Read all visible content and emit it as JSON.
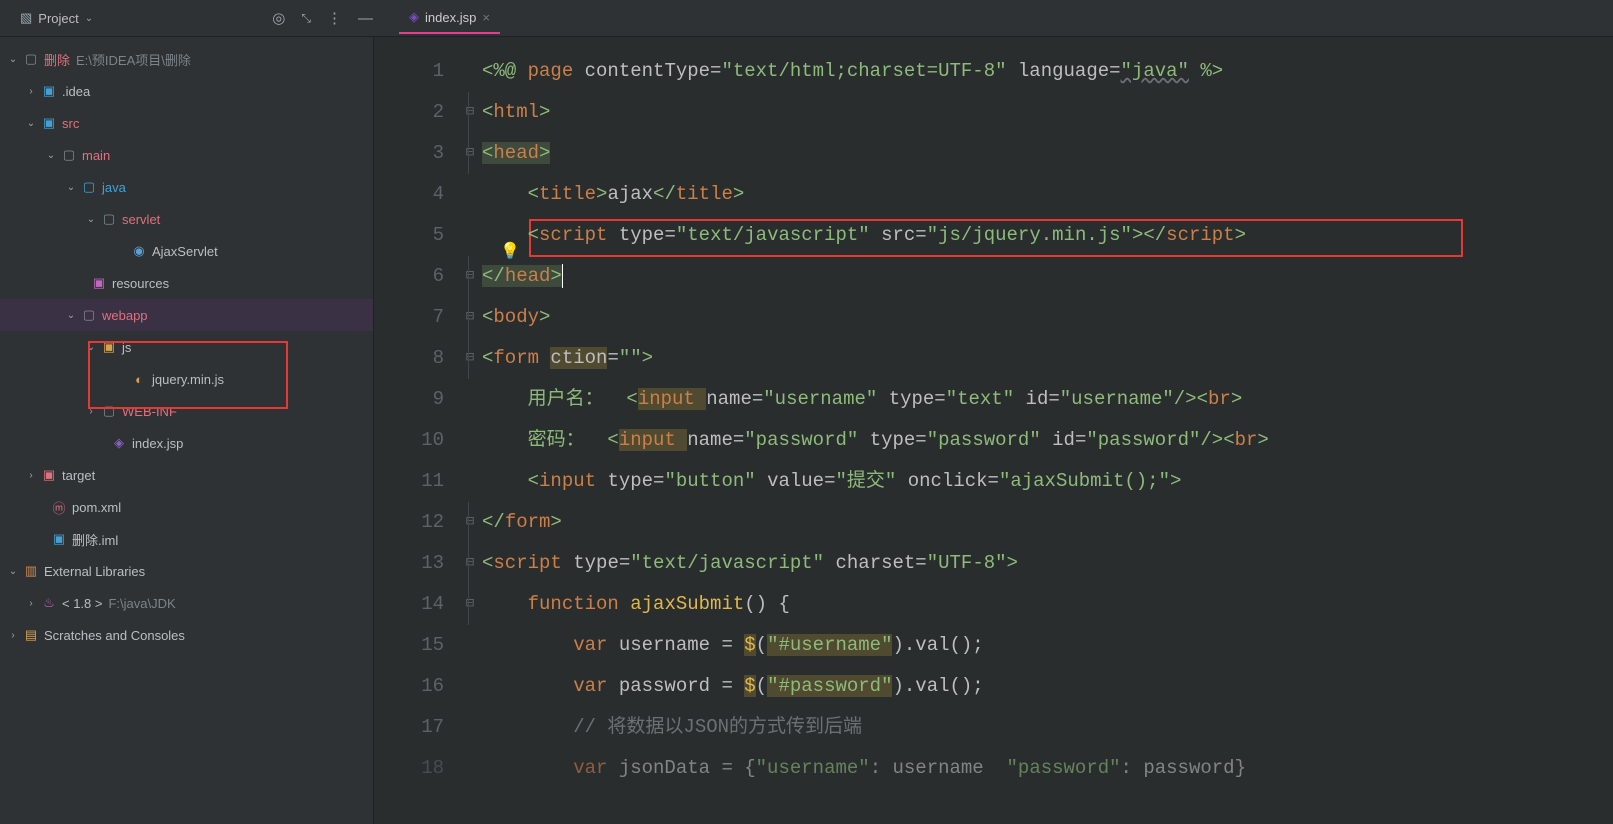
{
  "topbar": {
    "project_label": "Project",
    "icons": {
      "target": "target-icon",
      "collapse": "collapse-icon",
      "menu": "menu-icon",
      "minimize": "minimize-icon"
    }
  },
  "tab": {
    "file_label": "index.jsp"
  },
  "tree": {
    "root": {
      "label": "删除",
      "path": "E:\\预IDEA项目\\删除"
    },
    "idea": {
      "label": ".idea"
    },
    "src": {
      "label": "src"
    },
    "main": {
      "label": "main"
    },
    "java": {
      "label": "java"
    },
    "servlet": {
      "label": "servlet"
    },
    "ajaxServlet": {
      "label": "AjaxServlet"
    },
    "resources": {
      "label": "resources"
    },
    "webapp": {
      "label": "webapp"
    },
    "js": {
      "label": "js"
    },
    "jquery": {
      "label": "jquery.min.js"
    },
    "webinf": {
      "label": "WEB-INF"
    },
    "indexjsp": {
      "label": "index.jsp"
    },
    "target": {
      "label": "target"
    },
    "pom": {
      "label": "pom.xml"
    },
    "iml": {
      "label": "删除.iml"
    },
    "ext_lib": {
      "label": "External Libraries"
    },
    "jdk": {
      "label": "< 1.8 >",
      "path": "F:\\java\\JDK"
    },
    "scratches": {
      "label": "Scratches and Consoles"
    }
  },
  "code": {
    "l1": {
      "a": "<%@ ",
      "b": "page ",
      "c": "contentType=",
      "d": "\"text/html;charset=UTF-8\"",
      "e": " language=",
      "f": "\"java\"",
      "g": " %>"
    },
    "l2": {
      "a": "<",
      "b": "html",
      "c": ">"
    },
    "l3": {
      "a": "<",
      "b": "head",
      "c": ">"
    },
    "l4": {
      "a": "    <",
      "b": "title",
      "c": ">",
      "d": "ajax",
      "e": "</",
      "f": "title",
      "g": ">"
    },
    "l5": {
      "a": "    <",
      "b": "script ",
      "c": "type=",
      "d": "\"text/javascript\"",
      "e": " src=",
      "f": "\"js/jquery.min.js\"",
      "g": "></",
      "h": "script",
      "i": ">"
    },
    "l6": {
      "a": "</",
      "b": "head",
      "c": ">"
    },
    "l7": {
      "a": "<",
      "b": "body",
      "c": ">"
    },
    "l8": {
      "a": "<",
      "b": "form ",
      "c": "ction",
      "d": "=",
      "e": "\"\"",
      "f": ">"
    },
    "l9": {
      "a": "    用户名：  <",
      "b": "input ",
      "c": "name=",
      "d": "\"username\"",
      "e": " type=",
      "f": "\"text\"",
      "g": " id=",
      "h": "\"username\"",
      "i": "/><",
      "j": "br",
      "k": ">"
    },
    "l10": {
      "a": "    密码：  <",
      "b": "input ",
      "c": "name=",
      "d": "\"password\"",
      "e": " type=",
      "f": "\"password\"",
      "g": " id=",
      "h": "\"password\"",
      "i": "/><",
      "j": "br",
      "k": ">"
    },
    "l11": {
      "a": "    <",
      "b": "input ",
      "c": "type=",
      "d": "\"button\"",
      "e": " value=",
      "f": "\"提交\"",
      "g": " onclick=",
      "h": "\"ajaxSubmit();\"",
      "i": ">"
    },
    "l12": {
      "a": "</",
      "b": "form",
      "c": ">"
    },
    "l13": {
      "a": "<",
      "b": "script ",
      "c": "type=",
      "d": "\"text/javascript\"",
      "e": " charset=",
      "f": "\"UTF-8\"",
      "g": ">"
    },
    "l14": {
      "a": "    ",
      "b": "function ",
      "c": "ajaxSubmit",
      "d": "() {"
    },
    "l15": {
      "a": "        ",
      "b": "var ",
      "c": "username = ",
      "d": "$",
      "e": "(",
      "f": "\"#username\"",
      "g": ").val();"
    },
    "l16": {
      "a": "        ",
      "b": "var ",
      "c": "password = ",
      "d": "$",
      "e": "(",
      "f": "\"#password\"",
      "g": ").val();"
    },
    "l17": {
      "a": "        ",
      "b": "// 将数据以JSON的方式传到后端"
    },
    "l18": {
      "a": "        ",
      "b": "var ",
      "c": "jsonData = {",
      "d": "\"username\"",
      "e": ": username  ",
      "f": "\"password\"",
      "g": ": password}"
    }
  },
  "line_numbers": [
    "1",
    "2",
    "3",
    "4",
    "5",
    "6",
    "7",
    "8",
    "9",
    "10",
    "11",
    "12",
    "13",
    "14",
    "15",
    "16",
    "17",
    "18"
  ]
}
